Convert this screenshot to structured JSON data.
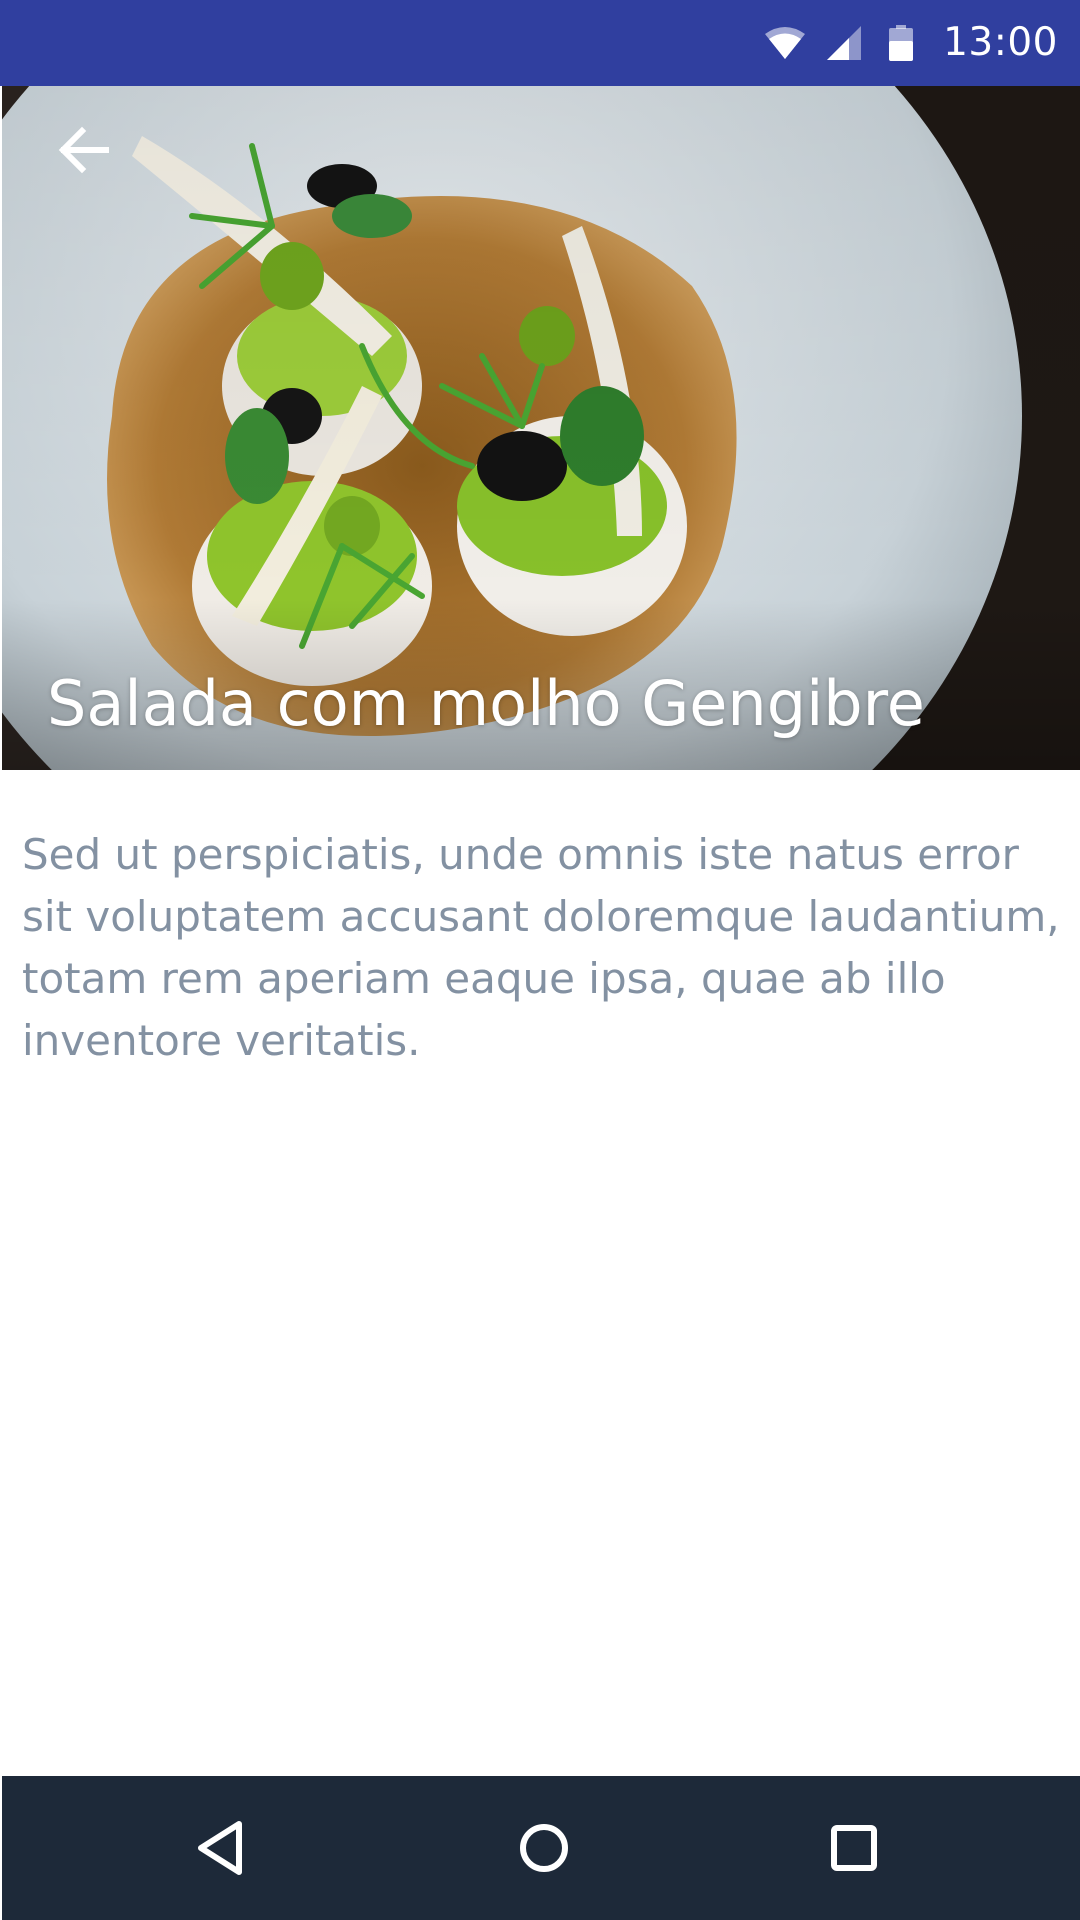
{
  "status_bar": {
    "time": "13:00",
    "icons": [
      "wifi-icon",
      "cell-signal-icon",
      "battery-icon"
    ],
    "background": "#303f9f"
  },
  "hero": {
    "title": "Salada com molho Gengibre",
    "image_subject": "plated salad with sauce",
    "back_icon": "arrow-left-icon"
  },
  "content": {
    "description": "Sed ut perspiciatis, unde omnis iste natus error sit voluptatem accusant doloremque laudantium, totam rem aperiam eaque ipsa, quae ab illo inventore veritatis."
  },
  "nav_bar": {
    "buttons": [
      "nav-back-icon",
      "nav-home-icon",
      "nav-recents-icon"
    ],
    "background": "#1d2939"
  },
  "colors": {
    "description_text": "#8391a2",
    "title_text": "#ffffff"
  }
}
